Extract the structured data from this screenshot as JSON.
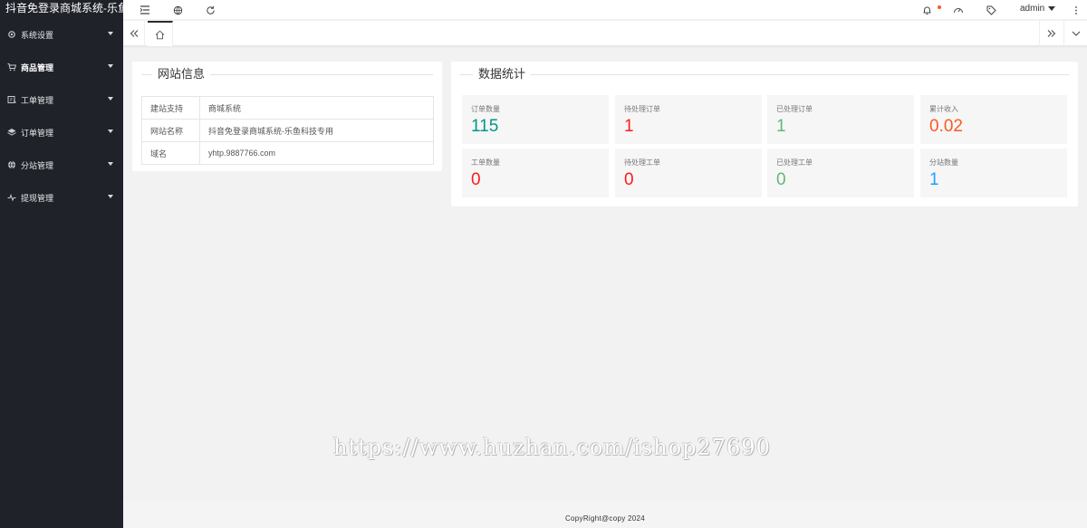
{
  "app": {
    "title": "抖音免登录商城系统-乐鱼"
  },
  "sidebar": {
    "items": [
      {
        "label": "系统设置",
        "icon": "gear-icon"
      },
      {
        "label": "商品管理",
        "icon": "cart-icon"
      },
      {
        "label": "工单管理",
        "icon": "ticket-icon"
      },
      {
        "label": "订单管理",
        "icon": "layers-icon"
      },
      {
        "label": "分站管理",
        "icon": "globe-icon"
      },
      {
        "label": "提现管理",
        "icon": "pulse-icon"
      }
    ]
  },
  "header": {
    "user": "admin"
  },
  "site_info": {
    "title": "网站信息",
    "rows": [
      {
        "key": "建站支持",
        "value": "商城系统"
      },
      {
        "key": "网站名称",
        "value": "抖音免登录商城系统-乐鱼科技专用"
      },
      {
        "key": "域名",
        "value": "yhtp.9887766.com"
      }
    ]
  },
  "stats": {
    "title": "数据统计",
    "items": [
      {
        "label": "订单数量",
        "value": "115",
        "color": "#009688"
      },
      {
        "label": "待处理订单",
        "value": "1",
        "color": "#ff1a1a"
      },
      {
        "label": "已处理订单",
        "value": "1",
        "color": "#5fb878"
      },
      {
        "label": "累计收入",
        "value": "0.02",
        "color": "#ff5722"
      },
      {
        "label": "工单数量",
        "value": "0",
        "color": "#ff1a1a"
      },
      {
        "label": "待处理工单",
        "value": "0",
        "color": "#ff1a1a"
      },
      {
        "label": "已处理工单",
        "value": "0",
        "color": "#5fb878"
      },
      {
        "label": "分站数量",
        "value": "1",
        "color": "#1e9fff"
      }
    ]
  },
  "footer": {
    "text": "CopyRight@copy 2024"
  },
  "watermark": {
    "text": "https://www.huzhan.com/ishop27690"
  }
}
